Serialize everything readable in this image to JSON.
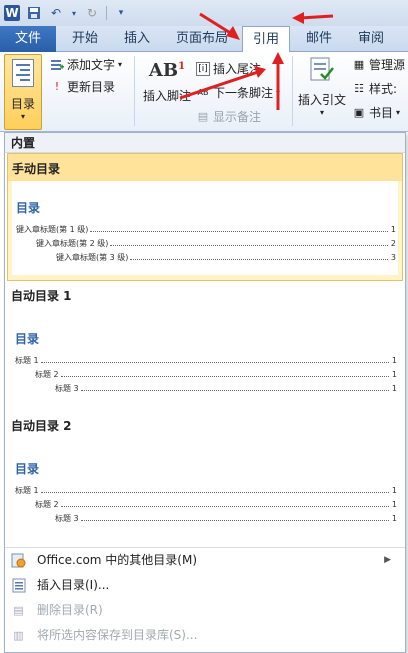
{
  "qat": {
    "logo": "W"
  },
  "tabs": [
    {
      "label": "文件"
    },
    {
      "label": "开始"
    },
    {
      "label": "插入"
    },
    {
      "label": "页面布局"
    },
    {
      "label": "引用"
    },
    {
      "label": "邮件"
    },
    {
      "label": "审阅"
    }
  ],
  "ribbon": {
    "toc_label": "目录",
    "add_text": "添加文字",
    "update_toc": "更新目录",
    "insert_footnote": "插入脚注",
    "insert_endnote": "插入尾注",
    "next_footnote": "下一条脚注",
    "show_notes": "显示备注",
    "insert_citation": "插入引文",
    "manage_sources": "管理源",
    "style_label": "样式:",
    "bibliography": "书目"
  },
  "dropdown": {
    "builtin": "内置",
    "items": [
      {
        "title": "手动目录",
        "toc_head": "目录",
        "lines": [
          {
            "text": "键入章标题(第 1 级)",
            "page": "1"
          },
          {
            "text": "键入章标题(第 2 级)",
            "page": "2"
          },
          {
            "text": "键入章标题(第 3 级)",
            "page": "3"
          }
        ]
      },
      {
        "title": "自动目录 1",
        "toc_head": "目录",
        "lines": [
          {
            "text": "标题 1",
            "page": "1"
          },
          {
            "text": "标题 2",
            "page": "1"
          },
          {
            "text": "标题 3",
            "page": "1"
          }
        ]
      },
      {
        "title": "自动目录 2",
        "toc_head": "目录",
        "lines": [
          {
            "text": "标题 1",
            "page": "1"
          },
          {
            "text": "标题 2",
            "page": "1"
          },
          {
            "text": "标题 3",
            "page": "1"
          }
        ]
      }
    ],
    "menu": [
      {
        "label": "Office.com 中的其他目录(M)"
      },
      {
        "label": "插入目录(I)..."
      },
      {
        "label": "删除目录(R)"
      },
      {
        "label": "将所选内容保存到目录库(S)..."
      }
    ]
  },
  "colors": {
    "accent": "#2b579a",
    "highlight": "#ffcf5a",
    "annotation": "#e02020"
  }
}
